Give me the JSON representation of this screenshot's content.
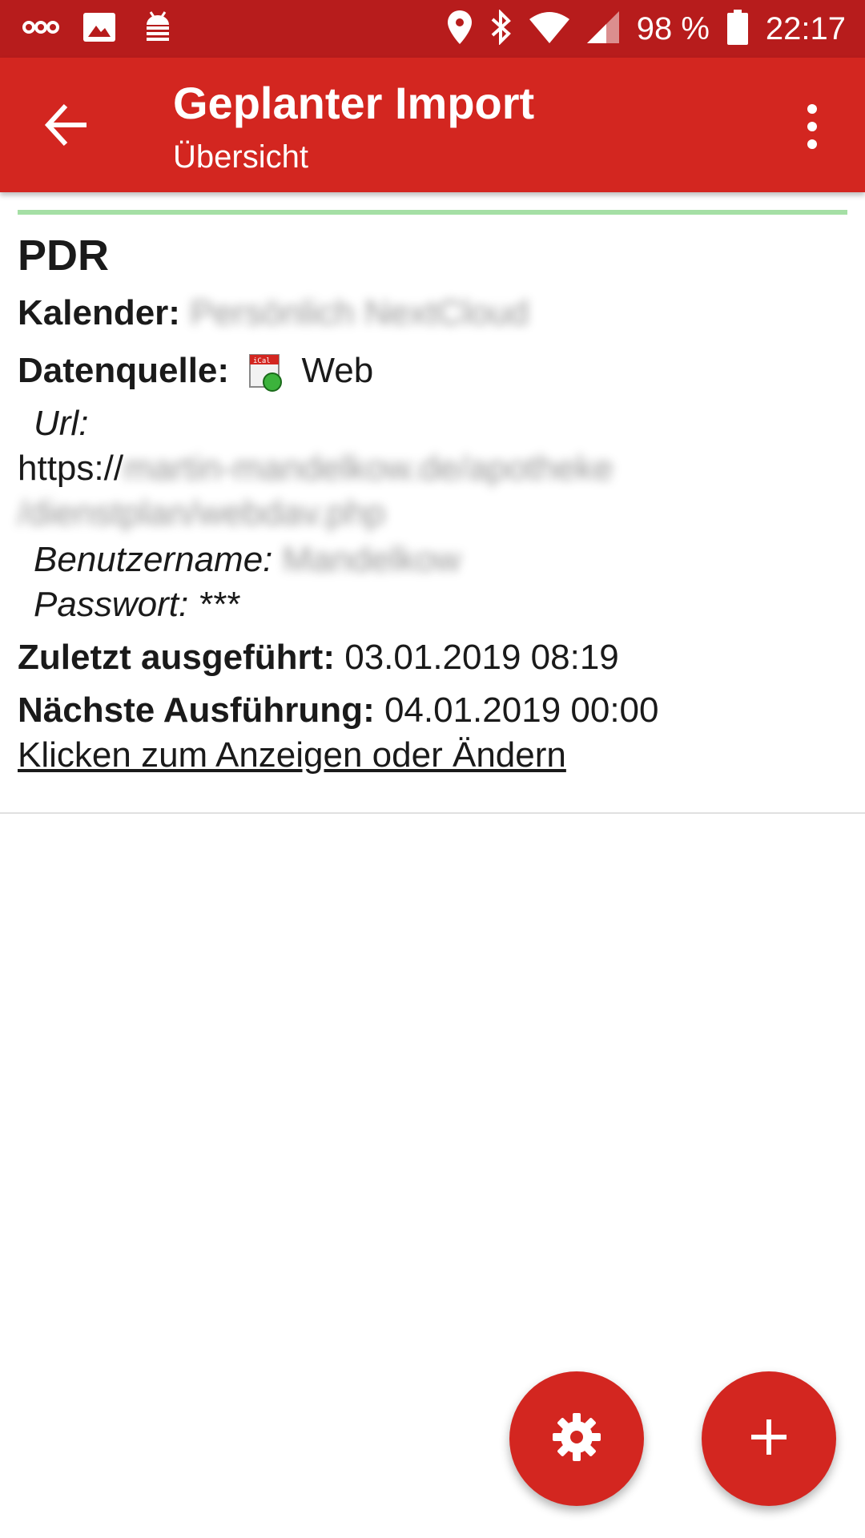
{
  "status_bar": {
    "battery": "98 %",
    "time": "22:17",
    "icons": [
      "infinity-icon",
      "image-icon",
      "android-debug-icon",
      "location-icon",
      "bluetooth-icon",
      "wifi-icon",
      "signal-icon",
      "battery-icon"
    ]
  },
  "appbar": {
    "title": "Geplanter Import",
    "subtitle": "Übersicht",
    "back_icon": "arrow-back-icon",
    "menu_icon": "more-vert-icon",
    "color": "#d32620"
  },
  "entry": {
    "name": "PDR",
    "calendar_label": "Kalender:",
    "calendar_value": "Persönlich NextCloud",
    "source_label": "Datenquelle:",
    "source_value": "Web",
    "url_label": "Url:",
    "url_prefix": "https://",
    "url_rest_line1": "martin-mandelkow.de/apotheke",
    "url_rest_line2": "/dienstplan/webdav.php",
    "username_label": "Benutzername:",
    "username_value": "Mandelkow",
    "password_label": "Passwort:",
    "password_value": "***",
    "last_run_label": "Zuletzt ausgeführt:",
    "last_run_value": "03.01.2019 08:19",
    "next_run_label": "Nächste Ausführung:",
    "next_run_value": "04.01.2019 00:00",
    "edit_link": "Klicken zum Anzeigen oder Ändern",
    "status_color": "#a5dfa5"
  },
  "fabs": {
    "settings_icon": "gear-icon",
    "add_icon": "plus-icon"
  }
}
